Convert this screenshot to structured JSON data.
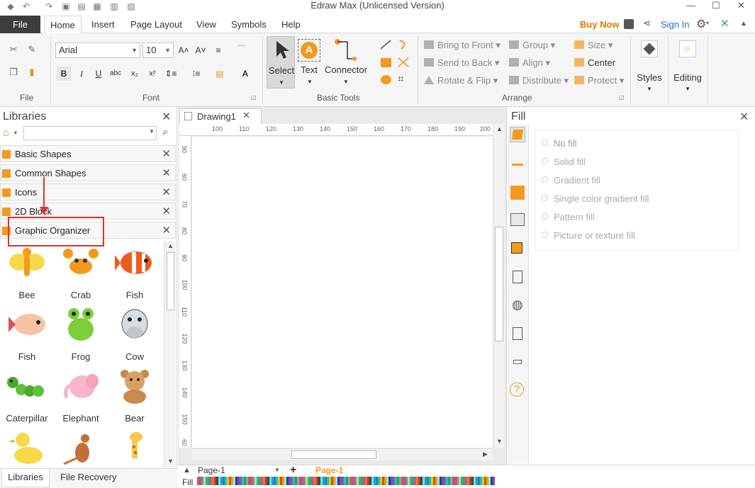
{
  "window": {
    "title": "Edraw Max (Unlicensed Version)"
  },
  "menu": {
    "file": "File",
    "tabs": [
      "Home",
      "Insert",
      "Page Layout",
      "View",
      "Symbols",
      "Help"
    ],
    "buy_now": "Buy Now",
    "sign_in": "Sign In"
  },
  "ribbon": {
    "groups": {
      "file": "File",
      "font": "Font",
      "basic_tools": "Basic Tools",
      "arrange": "Arrange"
    },
    "font_name": "Arial",
    "font_size": "10",
    "tools": {
      "select": "Select",
      "text": "Text",
      "connector": "Connector"
    },
    "arrange": {
      "bring_to_front": "Bring to Front",
      "send_to_back": "Send to Back",
      "rotate_flip": "Rotate & Flip",
      "group": "Group",
      "align": "Align",
      "distribute": "Distribute",
      "size": "Size",
      "center": "Center",
      "protect": "Protect"
    },
    "styles": "Styles",
    "editing": "Editing"
  },
  "libraries": {
    "title": "Libraries",
    "search_placeholder": "",
    "items": [
      {
        "name": "Basic Shapes"
      },
      {
        "name": "Common Shapes"
      },
      {
        "name": "Icons"
      },
      {
        "name": "2D Block"
      },
      {
        "name": "Graphic Organizer"
      }
    ],
    "shapes": [
      {
        "label": "Bee",
        "icon": "bee-icon"
      },
      {
        "label": "Crab",
        "icon": "crab-icon"
      },
      {
        "label": "Fish",
        "icon": "fish-icon"
      },
      {
        "label": "Fish",
        "icon": "fish-icon"
      },
      {
        "label": "Frog",
        "icon": "frog-icon"
      },
      {
        "label": "Cow",
        "icon": "cow-icon"
      },
      {
        "label": "Caterpillar",
        "icon": "caterpillar-icon"
      },
      {
        "label": "Elephant",
        "icon": "elephant-icon"
      },
      {
        "label": "Bear",
        "icon": "bear-icon"
      }
    ],
    "bottom_tabs": [
      "Libraries",
      "File Recovery"
    ]
  },
  "document": {
    "tab": "Drawing1",
    "ruler_h": [
      "100",
      "110",
      "120",
      "130",
      "140",
      "150",
      "160",
      "170",
      "180",
      "190",
      "200"
    ],
    "ruler_v": [
      "90",
      "60",
      "70",
      "80",
      "90",
      "100",
      "110",
      "120",
      "130",
      "140",
      "150",
      "60"
    ]
  },
  "fill": {
    "title": "Fill",
    "options": [
      "No fill",
      "Solid fill",
      "Gradient fill",
      "Single color gradient fill",
      "Pattern fill",
      "Picture or texture fill"
    ]
  },
  "pages": {
    "current": "Page-1",
    "tab": "Page-1",
    "fill_label": "Fill"
  },
  "colors": {
    "accent": "#f39a1e",
    "file_tab": "#3d3d3d",
    "buy": "#e07b00",
    "link": "#1e6fc9",
    "highlight": "#e03030"
  }
}
